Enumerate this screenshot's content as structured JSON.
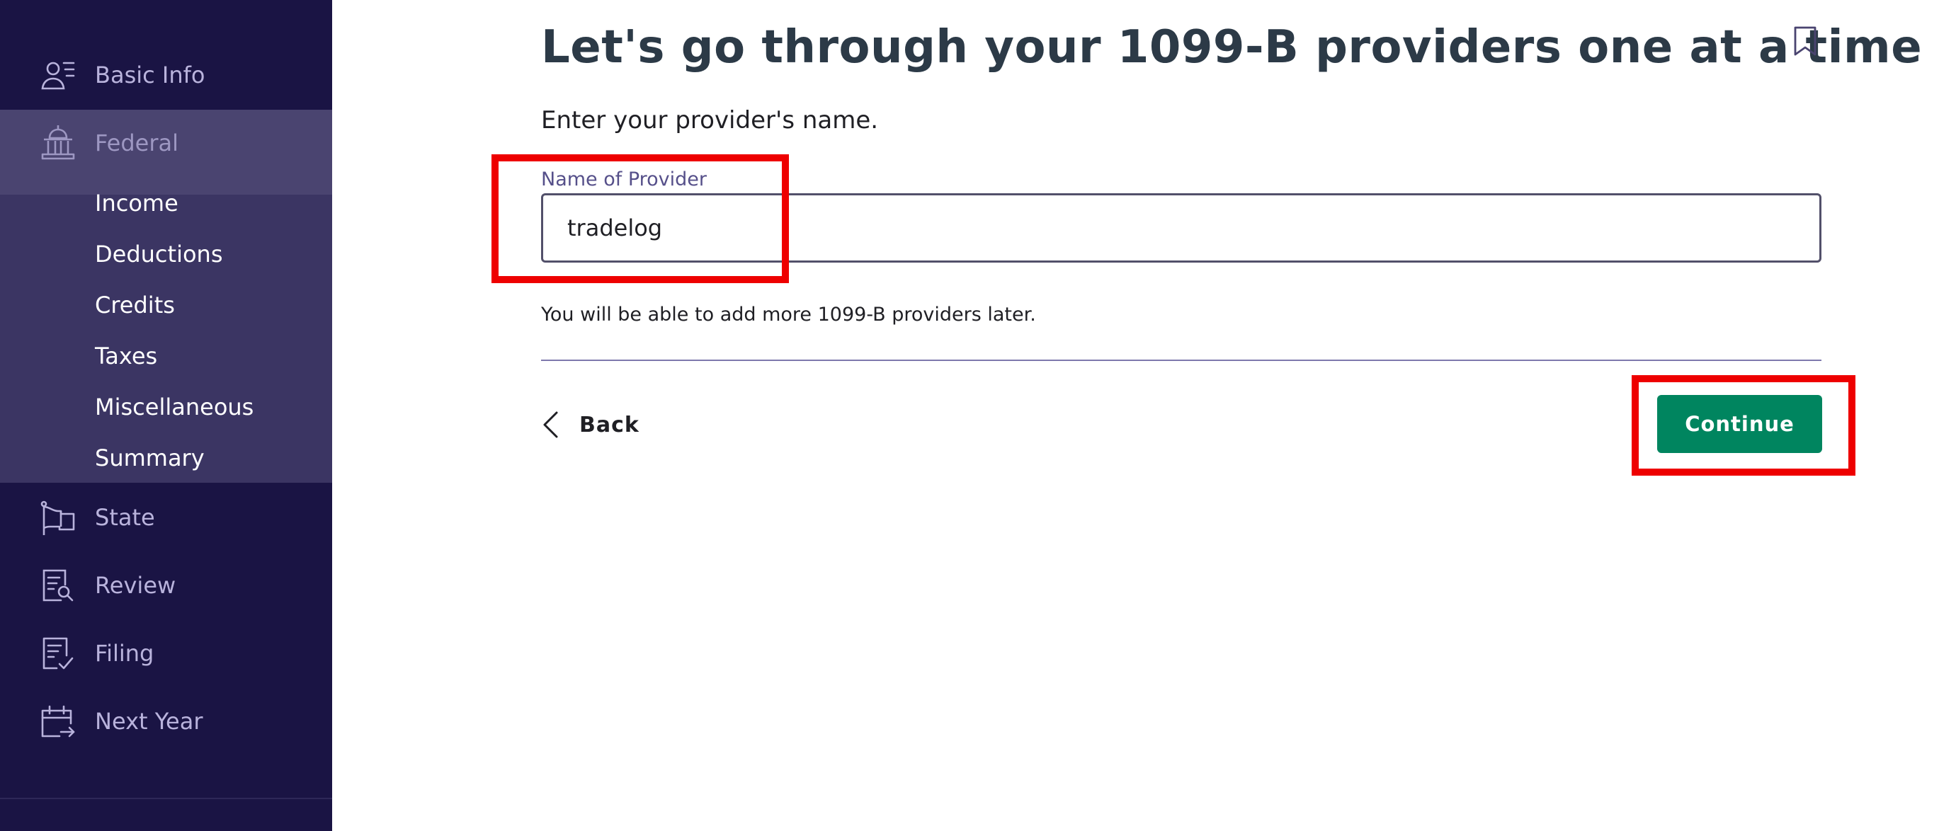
{
  "sidebar": {
    "items": [
      {
        "label": "Basic Info",
        "icon": "user-list-icon"
      },
      {
        "label": "Federal",
        "icon": "capitol-building-icon"
      },
      {
        "label": "State",
        "icon": "flag-icon"
      },
      {
        "label": "Review",
        "icon": "document-search-icon"
      },
      {
        "label": "Filing",
        "icon": "document-check-icon"
      },
      {
        "label": "Next Year",
        "icon": "calendar-arrow-icon"
      }
    ],
    "federal_subitems": [
      "Income",
      "Deductions",
      "Credits",
      "Taxes",
      "Miscellaneous",
      "Summary"
    ],
    "active_subitem": "Income"
  },
  "main": {
    "title": "Let's go through your 1099-B providers one at a time",
    "instruction": "Enter your provider's name.",
    "provider_field": {
      "label": "Name of Provider",
      "value": "tradelog"
    },
    "hint": "You will be able to add more 1099-B providers later.",
    "back_label": "Back",
    "continue_label": "Continue"
  },
  "colors": {
    "sidebar_bg": "#1a1444",
    "federal_group_bg": "#3b3563",
    "primary_button": "#00855f",
    "title_text": "#2c3a47",
    "highlight": "#ee0000"
  }
}
